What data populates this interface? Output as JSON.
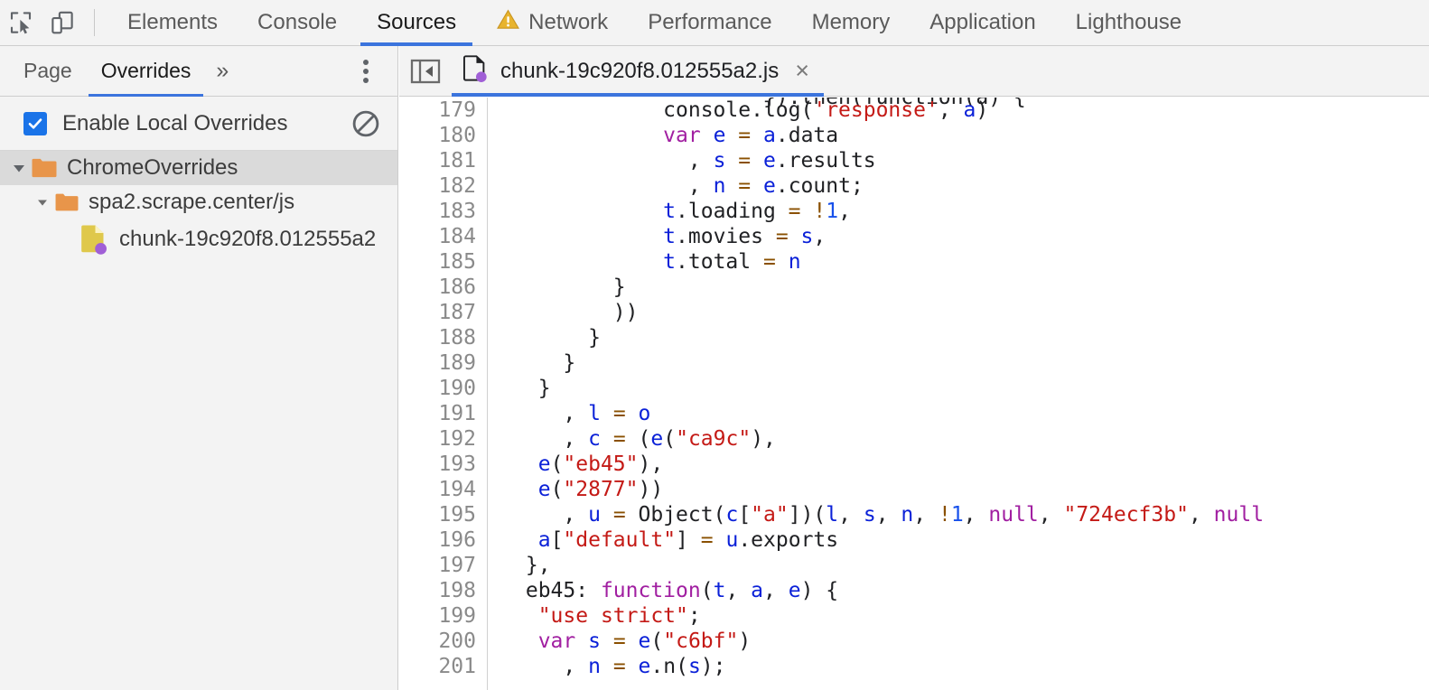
{
  "toolbar": {
    "inspect_icon": "cursor-select-icon",
    "device_icon": "device-toolbar-icon",
    "tabs": [
      {
        "label": "Elements",
        "active": false,
        "icon": null
      },
      {
        "label": "Console",
        "active": false,
        "icon": null
      },
      {
        "label": "Sources",
        "active": true,
        "icon": null
      },
      {
        "label": "Network",
        "active": false,
        "icon": "warning-triangle-icon"
      },
      {
        "label": "Performance",
        "active": false,
        "icon": null
      },
      {
        "label": "Memory",
        "active": false,
        "icon": null
      },
      {
        "label": "Application",
        "active": false,
        "icon": null
      },
      {
        "label": "Lighthouse",
        "active": false,
        "icon": null
      }
    ]
  },
  "navigator": {
    "tabs": [
      {
        "label": "Page",
        "active": false
      },
      {
        "label": "Overrides",
        "active": true
      }
    ],
    "more_tabs_label": "»",
    "kebab_label": "More options",
    "overrides": {
      "enable_label": "Enable Local Overrides",
      "enabled": true,
      "clear_icon": "clear-configuration-icon"
    },
    "tree": [
      {
        "label": "ChromeOverrides",
        "depth": 0,
        "icon": "folder-icon",
        "expanded": true,
        "selected": true
      },
      {
        "label": "spa2.scrape.center/js",
        "depth": 1,
        "icon": "folder-icon",
        "expanded": true,
        "selected": false
      },
      {
        "label": "chunk-19c920f8.012555a2",
        "depth": 2,
        "icon": "js-file-override-icon",
        "expanded": null,
        "selected": false
      }
    ]
  },
  "editor": {
    "collapse_icon": "collapse-navigator-icon",
    "tab": {
      "icon": "js-file-override-icon",
      "title": "chunk-19c920f8.012555a2.js",
      "close_label": "×"
    },
    "partial_top_line": "}).then(function(a) {",
    "first_line_number": 179,
    "lines": [
      {
        "n": 179,
        "tokens": [
          {
            "t": "            console.log(",
            "c": "def"
          },
          {
            "t": "'response'",
            "c": "str"
          },
          {
            "t": ", ",
            "c": "def"
          },
          {
            "t": "a",
            "c": "var"
          },
          {
            "t": ")",
            "c": "def"
          }
        ]
      },
      {
        "n": 180,
        "tokens": [
          {
            "t": "            ",
            "c": "def"
          },
          {
            "t": "var",
            "c": "kw"
          },
          {
            "t": " ",
            "c": "def"
          },
          {
            "t": "e",
            "c": "var"
          },
          {
            "t": " ",
            "c": "def"
          },
          {
            "t": "=",
            "c": "op"
          },
          {
            "t": " ",
            "c": "def"
          },
          {
            "t": "a",
            "c": "var"
          },
          {
            "t": ".data",
            "c": "def"
          }
        ]
      },
      {
        "n": 181,
        "tokens": [
          {
            "t": "              , ",
            "c": "def"
          },
          {
            "t": "s",
            "c": "var"
          },
          {
            "t": " ",
            "c": "def"
          },
          {
            "t": "=",
            "c": "op"
          },
          {
            "t": " ",
            "c": "def"
          },
          {
            "t": "e",
            "c": "var"
          },
          {
            "t": ".results",
            "c": "def"
          }
        ]
      },
      {
        "n": 182,
        "tokens": [
          {
            "t": "              , ",
            "c": "def"
          },
          {
            "t": "n",
            "c": "var"
          },
          {
            "t": " ",
            "c": "def"
          },
          {
            "t": "=",
            "c": "op"
          },
          {
            "t": " ",
            "c": "def"
          },
          {
            "t": "e",
            "c": "var"
          },
          {
            "t": ".count;",
            "c": "def"
          }
        ]
      },
      {
        "n": 183,
        "tokens": [
          {
            "t": "            ",
            "c": "def"
          },
          {
            "t": "t",
            "c": "var"
          },
          {
            "t": ".loading ",
            "c": "def"
          },
          {
            "t": "=",
            "c": "op"
          },
          {
            "t": " ",
            "c": "def"
          },
          {
            "t": "!",
            "c": "op"
          },
          {
            "t": "1",
            "c": "num"
          },
          {
            "t": ",",
            "c": "def"
          }
        ]
      },
      {
        "n": 184,
        "tokens": [
          {
            "t": "            ",
            "c": "def"
          },
          {
            "t": "t",
            "c": "var"
          },
          {
            "t": ".movies ",
            "c": "def"
          },
          {
            "t": "=",
            "c": "op"
          },
          {
            "t": " ",
            "c": "def"
          },
          {
            "t": "s",
            "c": "var"
          },
          {
            "t": ",",
            "c": "def"
          }
        ]
      },
      {
        "n": 185,
        "tokens": [
          {
            "t": "            ",
            "c": "def"
          },
          {
            "t": "t",
            "c": "var"
          },
          {
            "t": ".total ",
            "c": "def"
          },
          {
            "t": "=",
            "c": "op"
          },
          {
            "t": " ",
            "c": "def"
          },
          {
            "t": "n",
            "c": "var"
          }
        ]
      },
      {
        "n": 186,
        "tokens": [
          {
            "t": "        }",
            "c": "def"
          }
        ]
      },
      {
        "n": 187,
        "tokens": [
          {
            "t": "        ))",
            "c": "def"
          }
        ]
      },
      {
        "n": 188,
        "tokens": [
          {
            "t": "      }",
            "c": "def"
          }
        ]
      },
      {
        "n": 189,
        "tokens": [
          {
            "t": "    }",
            "c": "def"
          }
        ]
      },
      {
        "n": 190,
        "tokens": [
          {
            "t": "  }",
            "c": "def"
          }
        ]
      },
      {
        "n": 191,
        "tokens": [
          {
            "t": "    , ",
            "c": "def"
          },
          {
            "t": "l",
            "c": "var"
          },
          {
            "t": " ",
            "c": "def"
          },
          {
            "t": "=",
            "c": "op"
          },
          {
            "t": " ",
            "c": "def"
          },
          {
            "t": "o",
            "c": "var"
          }
        ]
      },
      {
        "n": 192,
        "tokens": [
          {
            "t": "    , ",
            "c": "def"
          },
          {
            "t": "c",
            "c": "var"
          },
          {
            "t": " ",
            "c": "def"
          },
          {
            "t": "=",
            "c": "op"
          },
          {
            "t": " (",
            "c": "def"
          },
          {
            "t": "e",
            "c": "var"
          },
          {
            "t": "(",
            "c": "def"
          },
          {
            "t": "\"ca9c\"",
            "c": "str"
          },
          {
            "t": "),",
            "c": "def"
          }
        ]
      },
      {
        "n": 193,
        "tokens": [
          {
            "t": "  ",
            "c": "def"
          },
          {
            "t": "e",
            "c": "var"
          },
          {
            "t": "(",
            "c": "def"
          },
          {
            "t": "\"eb45\"",
            "c": "str"
          },
          {
            "t": "),",
            "c": "def"
          }
        ]
      },
      {
        "n": 194,
        "tokens": [
          {
            "t": "  ",
            "c": "def"
          },
          {
            "t": "e",
            "c": "var"
          },
          {
            "t": "(",
            "c": "def"
          },
          {
            "t": "\"2877\"",
            "c": "str"
          },
          {
            "t": "))",
            "c": "def"
          }
        ]
      },
      {
        "n": 195,
        "tokens": [
          {
            "t": "    , ",
            "c": "def"
          },
          {
            "t": "u",
            "c": "var"
          },
          {
            "t": " ",
            "c": "def"
          },
          {
            "t": "=",
            "c": "op"
          },
          {
            "t": " Object(",
            "c": "def"
          },
          {
            "t": "c",
            "c": "var"
          },
          {
            "t": "[",
            "c": "def"
          },
          {
            "t": "\"a\"",
            "c": "str"
          },
          {
            "t": "])(",
            "c": "def"
          },
          {
            "t": "l",
            "c": "var"
          },
          {
            "t": ", ",
            "c": "def"
          },
          {
            "t": "s",
            "c": "var"
          },
          {
            "t": ", ",
            "c": "def"
          },
          {
            "t": "n",
            "c": "var"
          },
          {
            "t": ", ",
            "c": "def"
          },
          {
            "t": "!",
            "c": "op"
          },
          {
            "t": "1",
            "c": "num"
          },
          {
            "t": ", ",
            "c": "def"
          },
          {
            "t": "null",
            "c": "atom"
          },
          {
            "t": ", ",
            "c": "def"
          },
          {
            "t": "\"724ecf3b\"",
            "c": "str"
          },
          {
            "t": ", ",
            "c": "def"
          },
          {
            "t": "null",
            "c": "atom"
          }
        ]
      },
      {
        "n": 196,
        "tokens": [
          {
            "t": "  ",
            "c": "def"
          },
          {
            "t": "a",
            "c": "var"
          },
          {
            "t": "[",
            "c": "def"
          },
          {
            "t": "\"default\"",
            "c": "str"
          },
          {
            "t": "] ",
            "c": "def"
          },
          {
            "t": "=",
            "c": "op"
          },
          {
            "t": " ",
            "c": "def"
          },
          {
            "t": "u",
            "c": "var"
          },
          {
            "t": ".exports",
            "c": "def"
          }
        ]
      },
      {
        "n": 197,
        "tokens": [
          {
            "t": " },",
            "c": "def"
          }
        ]
      },
      {
        "n": 198,
        "tokens": [
          {
            "t": " eb45: ",
            "c": "def"
          },
          {
            "t": "function",
            "c": "kw"
          },
          {
            "t": "(",
            "c": "def"
          },
          {
            "t": "t",
            "c": "var"
          },
          {
            "t": ", ",
            "c": "def"
          },
          {
            "t": "a",
            "c": "var"
          },
          {
            "t": ", ",
            "c": "def"
          },
          {
            "t": "e",
            "c": "var"
          },
          {
            "t": ") {",
            "c": "def"
          }
        ]
      },
      {
        "n": 199,
        "tokens": [
          {
            "t": "  ",
            "c": "def"
          },
          {
            "t": "\"use strict\"",
            "c": "str"
          },
          {
            "t": ";",
            "c": "def"
          }
        ]
      },
      {
        "n": 200,
        "tokens": [
          {
            "t": "  ",
            "c": "def"
          },
          {
            "t": "var",
            "c": "kw"
          },
          {
            "t": " ",
            "c": "def"
          },
          {
            "t": "s",
            "c": "var"
          },
          {
            "t": " ",
            "c": "def"
          },
          {
            "t": "=",
            "c": "op"
          },
          {
            "t": " ",
            "c": "def"
          },
          {
            "t": "e",
            "c": "var"
          },
          {
            "t": "(",
            "c": "def"
          },
          {
            "t": "\"c6bf\"",
            "c": "str"
          },
          {
            "t": ")",
            "c": "def"
          }
        ]
      },
      {
        "n": 201,
        "tokens": [
          {
            "t": "    , ",
            "c": "def"
          },
          {
            "t": "n",
            "c": "var"
          },
          {
            "t": " ",
            "c": "def"
          },
          {
            "t": "=",
            "c": "op"
          },
          {
            "t": " ",
            "c": "def"
          },
          {
            "t": "e",
            "c": "var"
          },
          {
            "t": ".n(",
            "c": "def"
          },
          {
            "t": "s",
            "c": "var"
          },
          {
            "t": ");",
            "c": "def"
          }
        ]
      }
    ]
  },
  "colors": {
    "accent_blue": "#3b74dd",
    "checkbox_blue": "#1a73e8",
    "folder_orange": "#e8954a",
    "file_yellow": "#dfc84b",
    "override_purple": "#a05fd6",
    "warning_yellow": "#e8b42e",
    "toolbar_bg": "#f3f3f3",
    "selection_gray": "#dadada",
    "string_red": "#c41a16",
    "keyword_purple": "#a11fa1",
    "variable_blue": "#0b21d8",
    "operator_brown": "#8a5000"
  }
}
